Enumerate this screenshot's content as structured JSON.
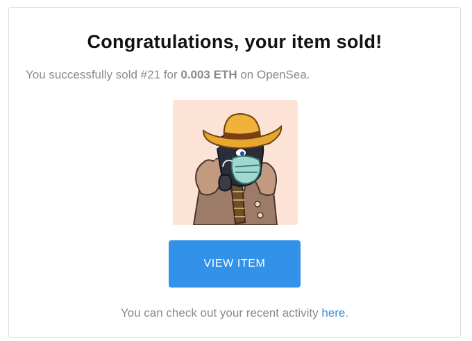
{
  "email": {
    "title": "Congratulations, your item sold!",
    "message": {
      "prefix": "You successfully sold #21 for ",
      "price": "0.003 ETH",
      "suffix": " on OpenSea."
    },
    "item_image": {
      "icon": "nft-character-cowboy-hat-mask-icon",
      "background_color": "#fde3d6"
    },
    "view_button_label": "VIEW ITEM",
    "view_button_color": "#3291e9",
    "footer": {
      "text": "You can check out your recent activity ",
      "link_text": "here",
      "suffix": "."
    },
    "link_color": "#3a8fd9"
  }
}
